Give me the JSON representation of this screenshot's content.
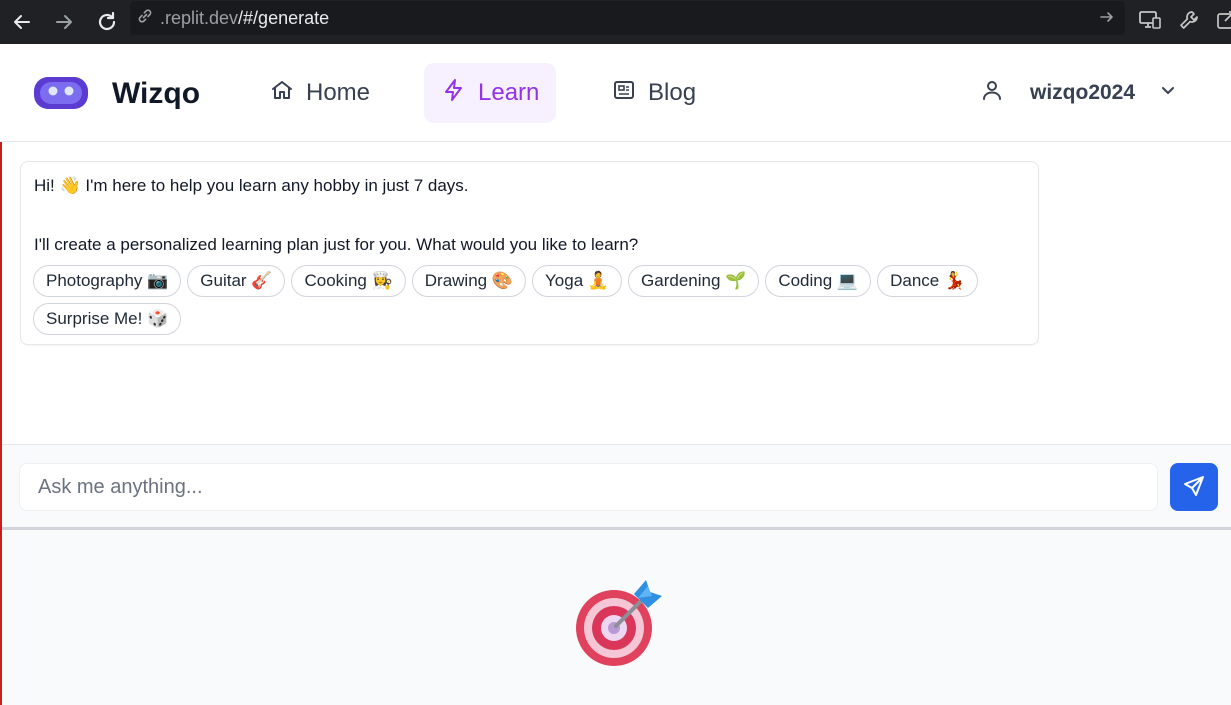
{
  "browser": {
    "url_dim": ".replit.dev",
    "url_path": "/#/generate"
  },
  "header": {
    "brand": "Wizqo",
    "nav": [
      {
        "label": "Home",
        "icon": "home-icon"
      },
      {
        "label": "Learn",
        "icon": "lightning-icon",
        "active": true
      },
      {
        "label": "Blog",
        "icon": "newspaper-icon"
      }
    ],
    "user": {
      "name": "wizqo2024",
      "icon": "user-icon"
    }
  },
  "chat": {
    "greeting": "Hi! 👋 I'm here to help you learn any hobby in just 7 days.",
    "prompt": "I'll create a personalized learning plan just for you. What would you like to learn?",
    "chips": [
      "Photography 📷",
      "Guitar 🎸",
      "Cooking 👩‍🍳",
      "Drawing 🎨",
      "Yoga 🧘",
      "Gardening 🌱",
      "Coding 💻",
      "Dance 💃",
      "Surprise Me! 🎲"
    ]
  },
  "input": {
    "placeholder": "Ask me anything..."
  },
  "lower": {
    "icon": "target-icon"
  },
  "colors": {
    "accent": "#9333ea",
    "accent_bg": "#f7f0ff",
    "send": "#2563eb",
    "logo": "#5b3bd1"
  }
}
